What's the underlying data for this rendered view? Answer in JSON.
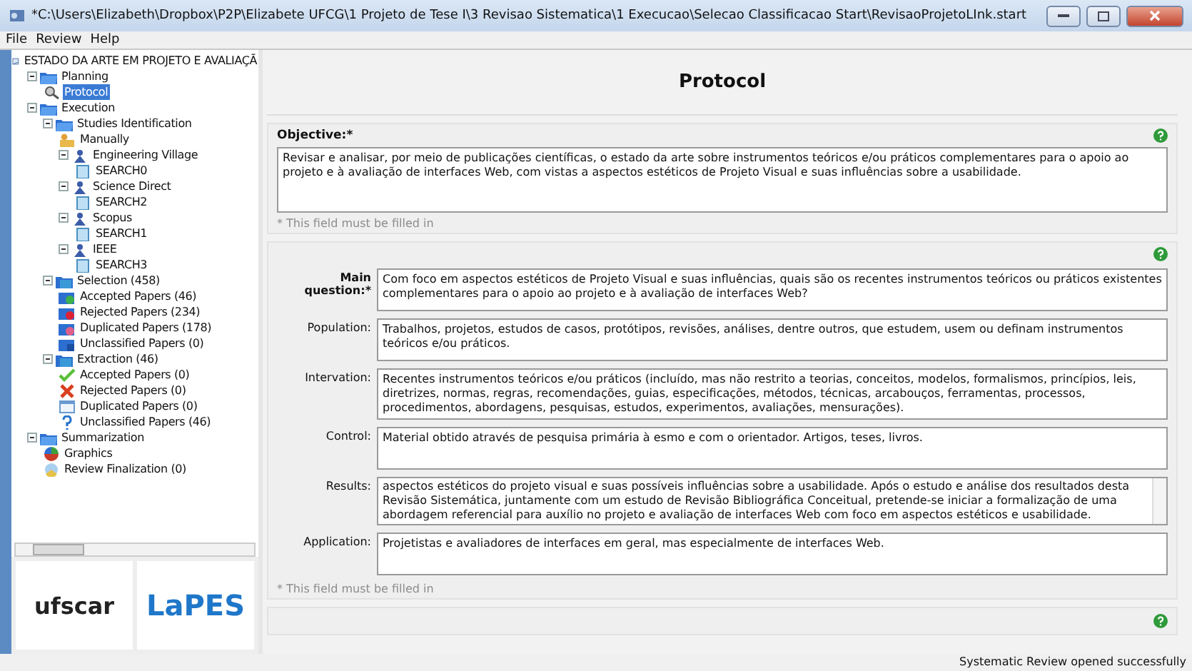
{
  "window": {
    "title": "*C:\\Users\\Elizabeth\\Dropbox\\P2P\\Elizabete UFCG\\1 Projeto de Tese I\\3 Revisao Sistematica\\1 Execucao\\Selecao Classificacao Start\\RevisaoProjetoLInk.start"
  },
  "menu": [
    "File",
    "Review",
    "Help"
  ],
  "tree": {
    "label": "ESTADO DA ARTE EM PROJETO E AVALIAÇÃ",
    "kind": "root",
    "children": [
      {
        "label": "Planning",
        "kind": "folder",
        "expanded": true,
        "children": [
          {
            "label": "Protocol",
            "kind": "protocol",
            "selected": true
          }
        ]
      },
      {
        "label": "Execution",
        "kind": "folder",
        "expanded": true,
        "children": [
          {
            "label": "Studies Identification",
            "kind": "folder",
            "expanded": true,
            "children": [
              {
                "label": "Manually",
                "kind": "manual",
                "selected": false
              },
              {
                "label": "Engineering Village",
                "kind": "source",
                "expanded": true,
                "children": [
                  {
                    "label": "SEARCH0",
                    "kind": "search",
                    "selected": false
                  }
                ]
              },
              {
                "label": "Science Direct",
                "kind": "source",
                "expanded": true,
                "children": [
                  {
                    "label": "SEARCH2",
                    "kind": "search",
                    "selected": false
                  }
                ]
              },
              {
                "label": "Scopus",
                "kind": "source",
                "expanded": true,
                "children": [
                  {
                    "label": "SEARCH1",
                    "kind": "search",
                    "selected": false
                  }
                ]
              },
              {
                "label": "IEEE",
                "kind": "source",
                "expanded": true,
                "children": [
                  {
                    "label": "SEARCH3",
                    "kind": "search",
                    "selected": false
                  }
                ]
              }
            ]
          },
          {
            "label": "Selection (458)",
            "kind": "stage",
            "expanded": true,
            "children": [
              {
                "label": "Accepted Papers (46)",
                "kind": "accepted",
                "selected": false
              },
              {
                "label": "Rejected Papers (234)",
                "kind": "rejected",
                "selected": false
              },
              {
                "label": "Duplicated Papers (178)",
                "kind": "duplicated",
                "selected": false
              },
              {
                "label": "Unclassified Papers (0)",
                "kind": "unclassified",
                "selected": false
              }
            ]
          },
          {
            "label": "Extraction (46)",
            "kind": "stage",
            "expanded": true,
            "children": [
              {
                "label": "Accepted Papers (0)",
                "kind": "check",
                "selected": false
              },
              {
                "label": "Rejected Papers (0)",
                "kind": "cross",
                "selected": false
              },
              {
                "label": "Duplicated Papers (0)",
                "kind": "page",
                "selected": false
              },
              {
                "label": "Unclassified Papers (46)",
                "kind": "question",
                "selected": false
              }
            ]
          }
        ]
      },
      {
        "label": "Summarization",
        "kind": "folder",
        "expanded": true,
        "children": [
          {
            "label": "Graphics",
            "kind": "chart",
            "selected": false
          },
          {
            "label": "Review Finalization (0)",
            "kind": "finalize",
            "selected": false
          }
        ]
      }
    ]
  },
  "logos": [
    "ufscar",
    "LaPES"
  ],
  "panel": {
    "title": "Protocol"
  },
  "objective": {
    "label": "Objective:*",
    "value": "Revisar e analisar, por meio de publicações científicas, o estado da arte sobre instrumentos teóricos e/ou práticos complementares para o apoio ao projeto e à avaliação de interfaces Web, com vistas a aspectos estéticos de Projeto Visual e suas influências sobre a usabilidade.",
    "hint": "* This field must be filled in"
  },
  "question": {
    "fields": [
      {
        "label": "Main question:*",
        "kind": "main",
        "value": "Com foco em aspectos estéticos de Projeto Visual e suas influências, quais são os recentes instrumentos teóricos ou práticos existentes complementares para o apoio ao projeto e à avaliação de interfaces Web?"
      },
      {
        "label": "Population:",
        "kind": "plain",
        "value": "Trabalhos, projetos, estudos de casos, protótipos, revisões, análises, dentre outros, que estudem, usem ou definam instrumentos teóricos e/ou práticos."
      },
      {
        "label": "Intervation:",
        "kind": "tall",
        "value": "Recentes instrumentos teóricos e/ou práticos (incluído, mas não restrito a teorias, conceitos, modelos, formalismos, princípios, leis, diretrizes, normas, regras, recomendações, guias, especificações, métodos, técnicas, arcabouços, ferramentas, processos, procedimentos, abordagens, pesquisas, estudos, experimentos, avaliações, mensurações)."
      },
      {
        "label": "Control:",
        "kind": "plain",
        "value": "Material obtido através de pesquisa primária à esmo e com o orientador. Artigos, teses, livros."
      },
      {
        "label": "Results:",
        "kind": "scroll",
        "value": "aspectos estéticos do projeto visual e suas possíveis influências sobre a usabilidade. Após o estudo e análise dos resultados desta Revisão Sistemática, juntamente com um estudo de Revisão Bibliográfica Conceitual, pretende-se iniciar a formalização de uma abordagem referencial para auxílio no projeto e avaliação de interfaces Web com foco em aspectos estéticos e usabilidade."
      },
      {
        "label": "Application:",
        "kind": "plain",
        "value": "Projetistas e avaliadores de interfaces em geral, mas especialmente de interfaces Web."
      }
    ],
    "hint": "* This field must be filled in"
  },
  "status_bar": "Systematic Review opened successfully"
}
